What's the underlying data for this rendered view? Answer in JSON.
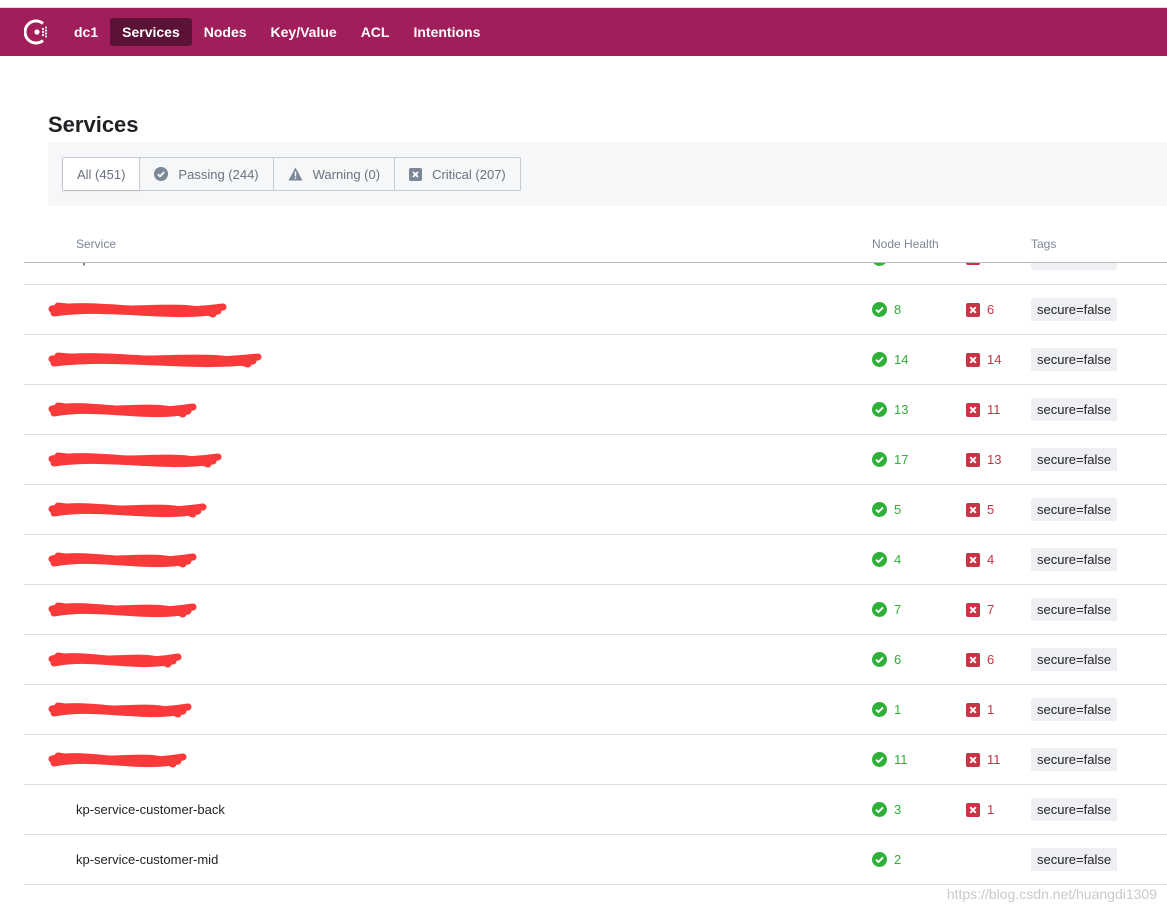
{
  "nav": {
    "datacenter": "dc1",
    "items": [
      {
        "label": "Services",
        "active": true
      },
      {
        "label": "Nodes"
      },
      {
        "label": "Key/Value"
      },
      {
        "label": "ACL"
      },
      {
        "label": "Intentions"
      }
    ],
    "brand_color": "#a01f5a"
  },
  "page": {
    "title": "Services"
  },
  "filters": [
    {
      "label": "All (451)",
      "icon": ""
    },
    {
      "label": "Passing (244)",
      "icon": "check-circle-icon"
    },
    {
      "label": "Warning (0)",
      "icon": "warning-icon"
    },
    {
      "label": "Critical (207)",
      "icon": "x-square-icon"
    }
  ],
  "table": {
    "headers": {
      "service": "Service",
      "health": "Node Health",
      "tags": "Tags"
    },
    "partial_row": {
      "name": "kp-server-mid-contact",
      "passing": "",
      "critical": "",
      "tag": "secure=false"
    },
    "rows": [
      {
        "name": "",
        "redacted": true,
        "passing": "8",
        "critical": "6",
        "tag": "secure=false"
      },
      {
        "name": "",
        "redacted": true,
        "passing": "14",
        "critical": "14",
        "tag": "secure=false"
      },
      {
        "name": "",
        "redacted": true,
        "passing": "13",
        "critical": "11",
        "tag": "secure=false"
      },
      {
        "name": "",
        "redacted": true,
        "passing": "17",
        "critical": "13",
        "tag": "secure=false"
      },
      {
        "name": "",
        "redacted": true,
        "passing": "5",
        "critical": "5",
        "tag": "secure=false"
      },
      {
        "name": "",
        "redacted": true,
        "passing": "4",
        "critical": "4",
        "tag": "secure=false"
      },
      {
        "name": "",
        "redacted": true,
        "passing": "7",
        "critical": "7",
        "tag": "secure=false"
      },
      {
        "name": "",
        "redacted": true,
        "passing": "6",
        "critical": "6",
        "tag": "secure=false"
      },
      {
        "name": "",
        "redacted": true,
        "passing": "1",
        "critical": "1",
        "tag": "secure=false"
      },
      {
        "name": "",
        "redacted": true,
        "passing": "11",
        "critical": "11",
        "tag": "secure=false"
      },
      {
        "name": "kp-service-customer-back",
        "redacted": false,
        "passing": "3",
        "critical": "1",
        "tag": "secure=false"
      },
      {
        "name": "kp-service-customer-mid",
        "redacted": false,
        "passing": "2",
        "critical": "",
        "tag": "secure=false"
      }
    ]
  },
  "colors": {
    "passing": "#2eb039",
    "critical": "#c73445"
  },
  "watermark": "https://blog.csdn.net/huangdi1309"
}
